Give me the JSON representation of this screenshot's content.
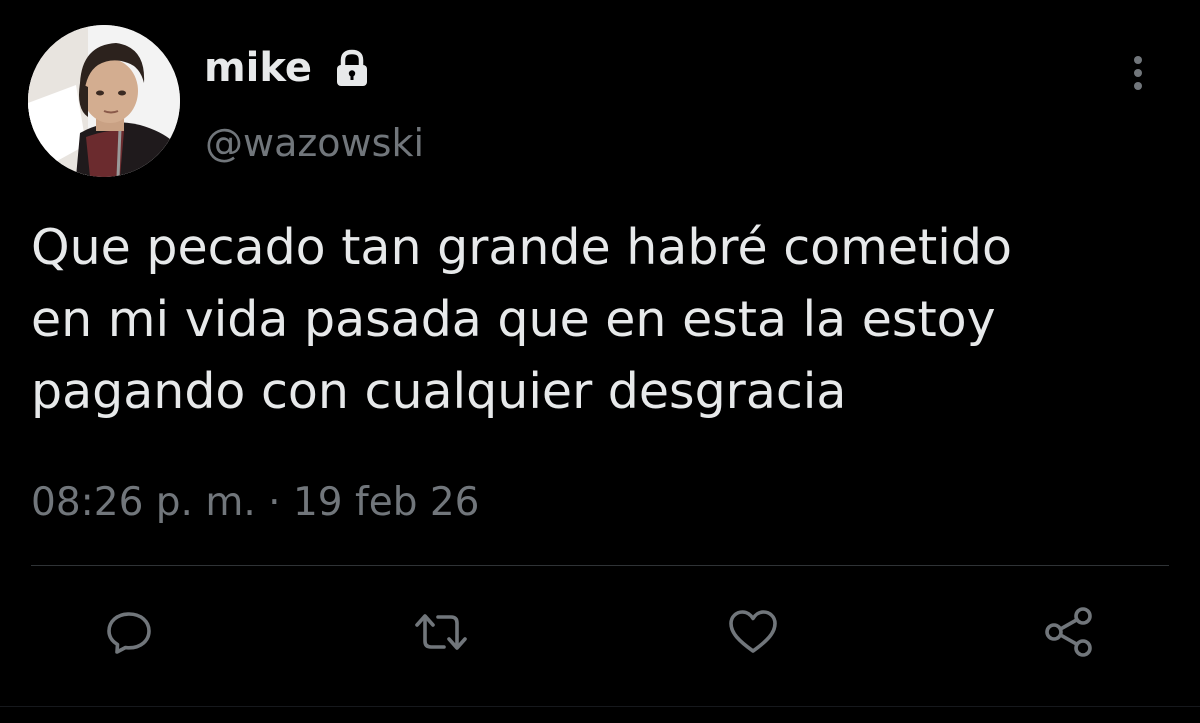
{
  "tweet": {
    "author": {
      "display_name": "mike",
      "handle": "@wazowski",
      "protected_icon": "lock-icon"
    },
    "text": "Que pecado tan grande habré cometido\nen mi vida pasada que en esta la estoy\npagando con cualquier desgracia",
    "time": "08:26 p. m.",
    "separator": "·",
    "date": "19 feb 26"
  },
  "actions": [
    {
      "name": "reply",
      "icon": "comment-icon"
    },
    {
      "name": "retweet",
      "icon": "retweet-icon"
    },
    {
      "name": "like",
      "icon": "heart-icon"
    },
    {
      "name": "share",
      "icon": "share-icon"
    }
  ],
  "menu": {
    "icon": "more-vertical-icon"
  },
  "colors": {
    "background": "#000000",
    "primary_text": "#e7e9ea",
    "secondary_text": "#71767b",
    "divider": "#2f3336"
  }
}
